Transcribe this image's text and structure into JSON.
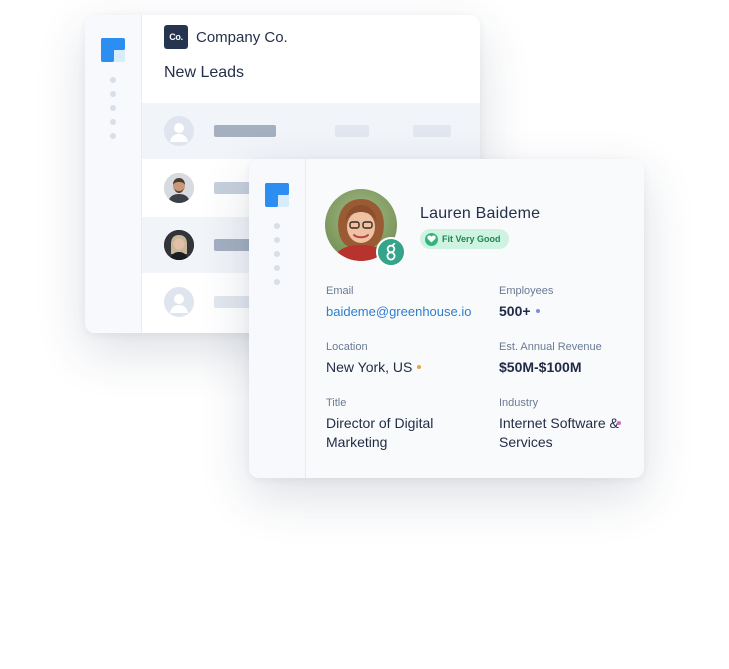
{
  "back_card": {
    "company_logo_text": "Co.",
    "company_name": "Company Co.",
    "list_title": "New Leads"
  },
  "profile": {
    "name": "Lauren Baideme",
    "fit_badge": "Fit Very Good",
    "fields": {
      "email_label": "Email",
      "email_value": "baideme@greenhouse.io",
      "employees_label": "Employees",
      "employees_value": "500+",
      "location_label": "Location",
      "location_value": "New York, US",
      "revenue_label": "Est. Annual Revenue",
      "revenue_value": "$50M-$100M",
      "title_label": "Title",
      "title_value": "Director of Digital Marketing",
      "industry_label": "Industry",
      "industry_value": "Internet Software & Services"
    }
  },
  "colors": {
    "accent_blue": "#2f7fd0",
    "fit_green": "#2eb67d",
    "greenhouse_green": "#36a48a",
    "employees_dot": "#7b8fd6",
    "location_dot": "#f2a13a",
    "industry_dot": "#d16ac9"
  },
  "icons": {
    "app_logo": "app-logo-icon",
    "placeholder_avatar": "user-silhouette-icon",
    "greenhouse": "greenhouse-g-icon",
    "fit": "heart-icon"
  }
}
